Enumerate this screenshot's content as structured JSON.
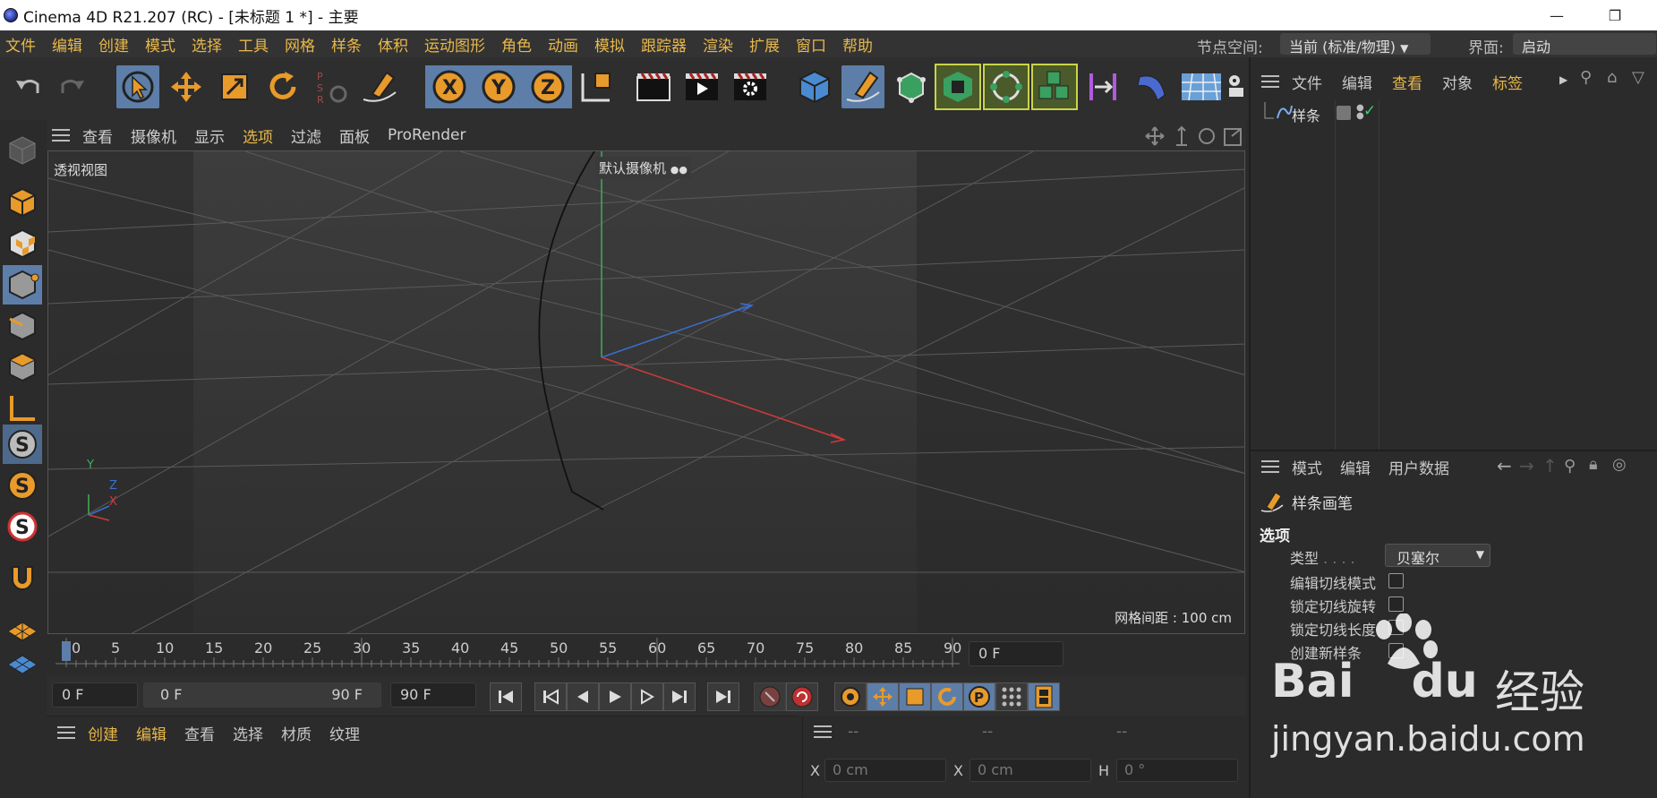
{
  "window": {
    "title": "Cinema 4D R21.207 (RC) - [未标题 1 *] - 主要"
  },
  "menubar": {
    "items": [
      "文件",
      "编辑",
      "创建",
      "模式",
      "选择",
      "工具",
      "网格",
      "样条",
      "体积",
      "运动图形",
      "角色",
      "动画",
      "模拟",
      "跟踪器",
      "渲染",
      "扩展",
      "窗口",
      "帮助"
    ],
    "node_space_label": "节点空间:",
    "node_space_value": "当前 (标准/物理)",
    "layout_label": "界面:",
    "layout_value": "启动"
  },
  "viewport": {
    "menu": [
      "查看",
      "摄像机",
      "显示",
      "选项",
      "过滤",
      "面板",
      "ProRender"
    ],
    "active_menu": "选项",
    "view_name": "透视视图",
    "camera_label": "默认摄像机",
    "grid_spacing": "网格间距 : 100 cm",
    "axis_x": "X",
    "axis_y": "Y",
    "axis_z": "Z"
  },
  "timeline": {
    "ticks": [
      "0",
      "5",
      "10",
      "15",
      "20",
      "25",
      "30",
      "35",
      "40",
      "45",
      "50",
      "55",
      "60",
      "65",
      "70",
      "75",
      "80",
      "85",
      "90"
    ],
    "current_frame": "0 F"
  },
  "transport": {
    "start_field": "0 F",
    "range_start": "0 F",
    "range_end": "90 F",
    "end_field": "90 F"
  },
  "material_manager": {
    "menu": [
      "创建",
      "编辑",
      "查看",
      "选择",
      "材质",
      "纹理"
    ]
  },
  "coord_manager": {
    "headers": [
      "--",
      "--",
      "--"
    ],
    "row1": [
      {
        "axis": "X",
        "value": "0 cm"
      },
      {
        "axis": "X",
        "value": "0 cm"
      },
      {
        "axis": "H",
        "value": "0 °"
      }
    ]
  },
  "object_manager": {
    "menu": [
      "文件",
      "编辑",
      "查看",
      "对象",
      "标签"
    ],
    "objects": [
      {
        "name": "样条"
      }
    ]
  },
  "attribute_manager": {
    "menu": [
      "模式",
      "编辑",
      "用户数据"
    ],
    "tool_name": "样条画笔",
    "section": "选项",
    "type_label": "类型",
    "type_value": "贝塞尔",
    "options": [
      "编辑切线模式",
      "锁定切线旋转",
      "锁定切线长度",
      "创建新样条"
    ]
  },
  "watermark": {
    "brand": "Bai",
    "brand2": "du",
    "product": "经验",
    "url": "jingyan.baidu.com"
  },
  "colors": {
    "accent": "#e8b84a",
    "selected": "#5d7ea8",
    "axis_x": "#d03a3a",
    "axis_y": "#3fae5a",
    "axis_z": "#3a6fd0"
  }
}
